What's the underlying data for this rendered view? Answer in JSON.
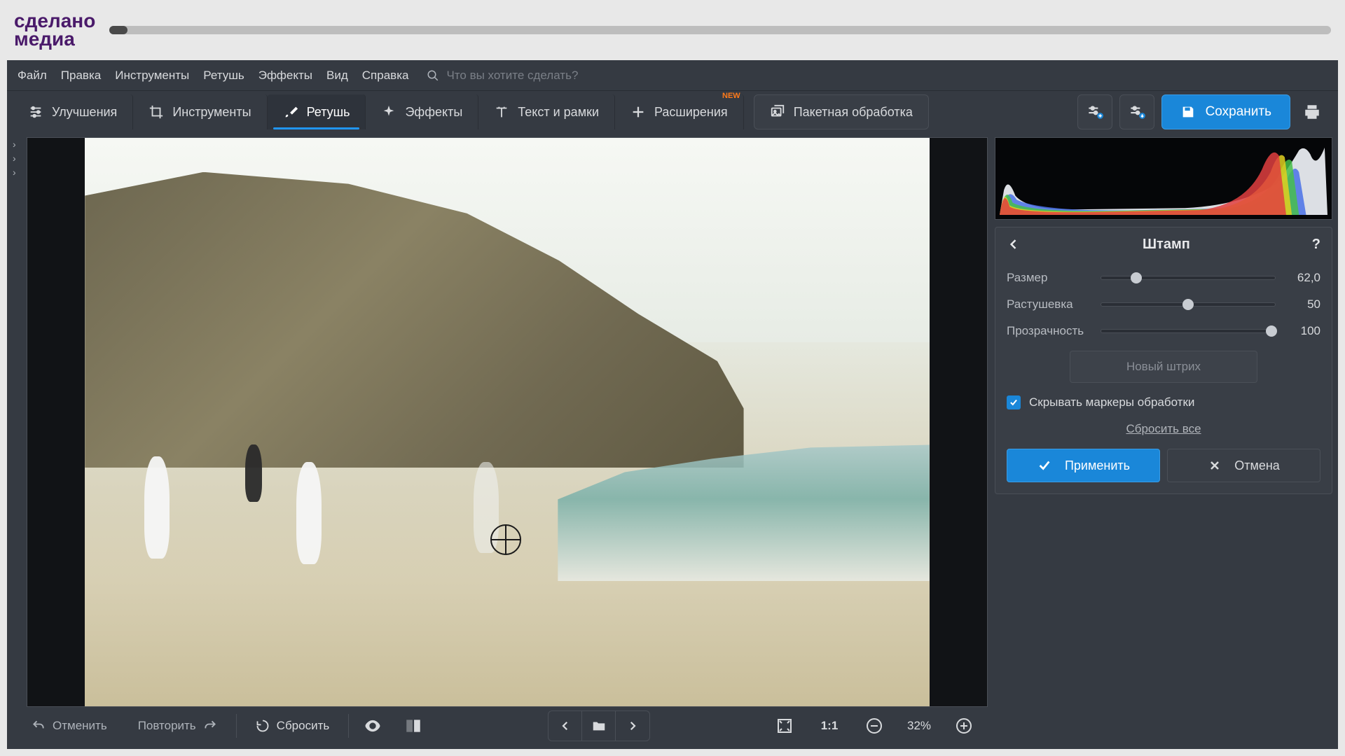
{
  "brand": {
    "line1": "сделано",
    "line2": "медиа"
  },
  "menu": {
    "file": "Файл",
    "edit": "Правка",
    "tools": "Инструменты",
    "retouch": "Ретушь",
    "effects": "Эффекты",
    "view": "Вид",
    "help": "Справка"
  },
  "search": {
    "placeholder": "Что вы хотите сделать?"
  },
  "tabs": {
    "enhance": "Улучшения",
    "tools": "Инструменты",
    "retouch": "Ретушь",
    "effects": "Эффекты",
    "text": "Текст и рамки",
    "addons": "Расширения",
    "addons_badge": "NEW",
    "batch": "Пакетная обработка"
  },
  "save_label": "Сохранить",
  "bottom": {
    "undo": "Отменить",
    "redo": "Повторить",
    "reset": "Сбросить",
    "oneToOne": "1:1",
    "zoom": "32%"
  },
  "panel": {
    "title": "Штамп",
    "sliders": {
      "size": {
        "label": "Размер",
        "value": "62,0",
        "pct": 20
      },
      "feather": {
        "label": "Растушевка",
        "value": "50",
        "pct": 50
      },
      "opacity": {
        "label": "Прозрачность",
        "value": "100",
        "pct": 100
      }
    },
    "newStroke": "Новый штрих",
    "hideMarkers": "Скрывать маркеры обработки",
    "resetAll": "Сбросить все",
    "apply": "Применить",
    "cancel": "Отмена"
  },
  "colors": {
    "accent": "#1a87d9"
  }
}
